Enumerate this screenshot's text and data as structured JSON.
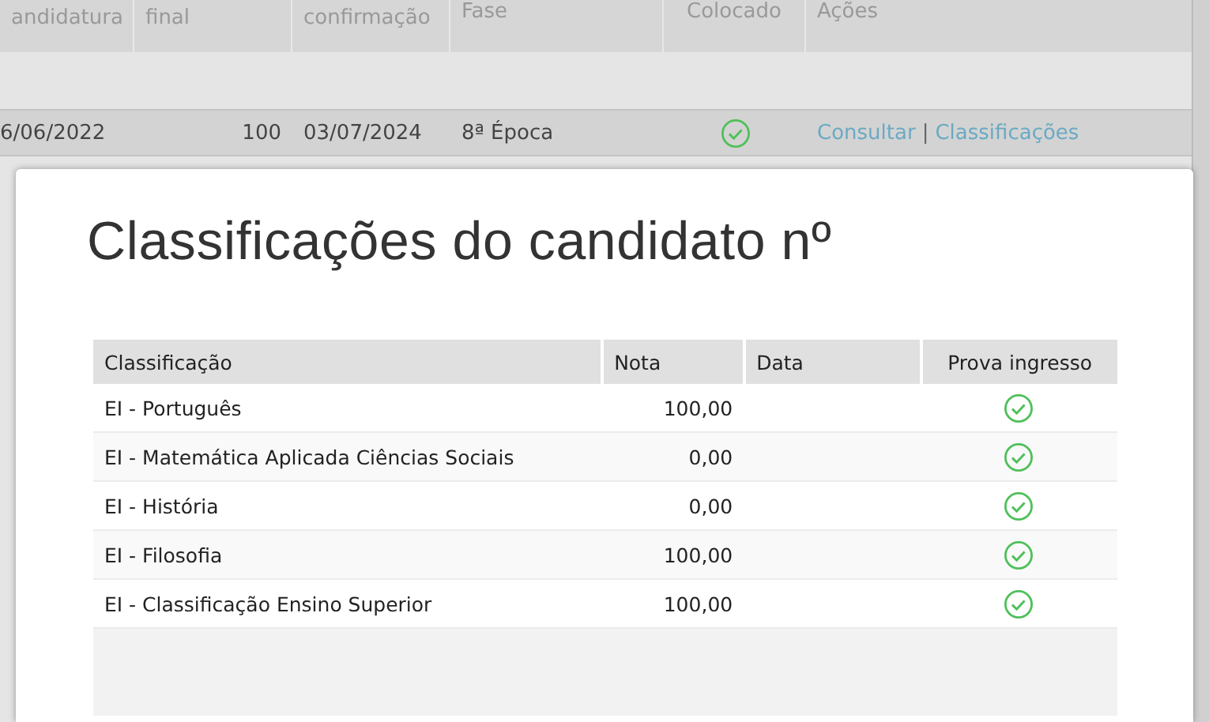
{
  "background_table": {
    "columns": [
      "andidatura",
      "final",
      "confirmação",
      "Fase",
      "Colocado",
      "Ações"
    ],
    "rows": [
      {
        "cells": [
          "6/06/2022",
          "100",
          "03/07/2024",
          "8ª Época"
        ],
        "placed": true,
        "actions": [
          "Consultar",
          "Classificações"
        ],
        "separator": "|"
      }
    ]
  },
  "modal": {
    "title": "Classificações do candidato nº",
    "columns": [
      "Classificação",
      "Nota",
      "Data",
      "Prova ingresso"
    ],
    "rows": [
      {
        "name": "EI - Português",
        "grade": "100,00",
        "entrance_exam": true
      },
      {
        "name": "EI - Matemática Aplicada Ciências Sociais",
        "grade": "0,00",
        "entrance_exam": true
      },
      {
        "name": "EI - História",
        "grade": "0,00",
        "entrance_exam": true
      },
      {
        "name": "EI - Filosofia",
        "grade": "100,00",
        "entrance_exam": true
      },
      {
        "name": "EI - Classificação Ensino Superior",
        "grade": "100,00",
        "entrance_exam": true
      }
    ]
  }
}
